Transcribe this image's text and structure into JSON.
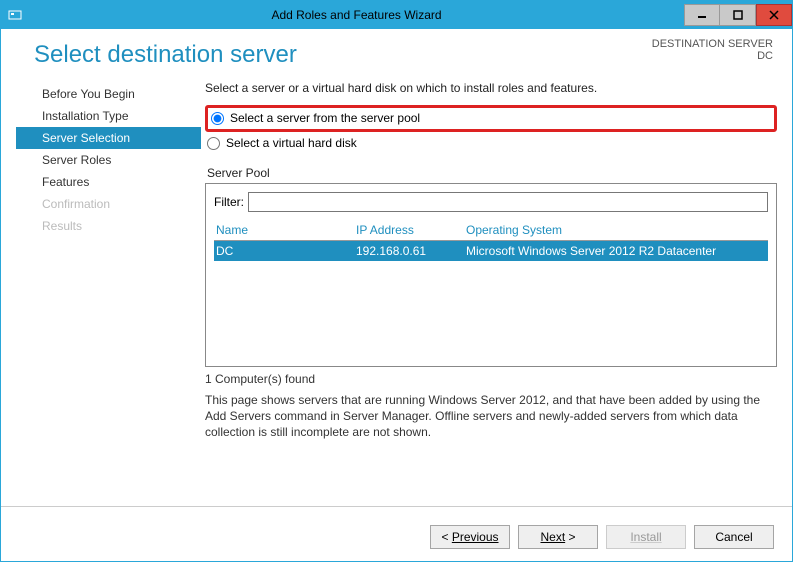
{
  "window": {
    "title": "Add Roles and Features Wizard"
  },
  "header": {
    "pageTitle": "Select destination server",
    "destLabel": "DESTINATION SERVER",
    "destValue": "DC"
  },
  "sidebar": {
    "items": [
      {
        "label": "Before You Begin",
        "state": "normal"
      },
      {
        "label": "Installation Type",
        "state": "normal"
      },
      {
        "label": "Server Selection",
        "state": "active"
      },
      {
        "label": "Server Roles",
        "state": "normal"
      },
      {
        "label": "Features",
        "state": "normal"
      },
      {
        "label": "Confirmation",
        "state": "disabled"
      },
      {
        "label": "Results",
        "state": "disabled"
      }
    ]
  },
  "main": {
    "instruction": "Select a server or a virtual hard disk on which to install roles and features.",
    "radio1": "Select a server from the server pool",
    "radio2": "Select a virtual hard disk",
    "poolLabel": "Server Pool",
    "filterLabel": "Filter:",
    "filterValue": "",
    "columns": {
      "name": "Name",
      "ip": "IP Address",
      "os": "Operating System"
    },
    "rows": [
      {
        "name": "DC",
        "ip": "192.168.0.61",
        "os": "Microsoft Windows Server 2012 R2 Datacenter"
      }
    ],
    "found": "1 Computer(s) found",
    "footnote": "This page shows servers that are running Windows Server 2012, and that have been added by using the Add Servers command in Server Manager. Offline servers and newly-added servers from which data collection is still incomplete are not shown."
  },
  "footer": {
    "previous": "Previous",
    "next": "Next",
    "install": "Install",
    "cancel": "Cancel"
  }
}
